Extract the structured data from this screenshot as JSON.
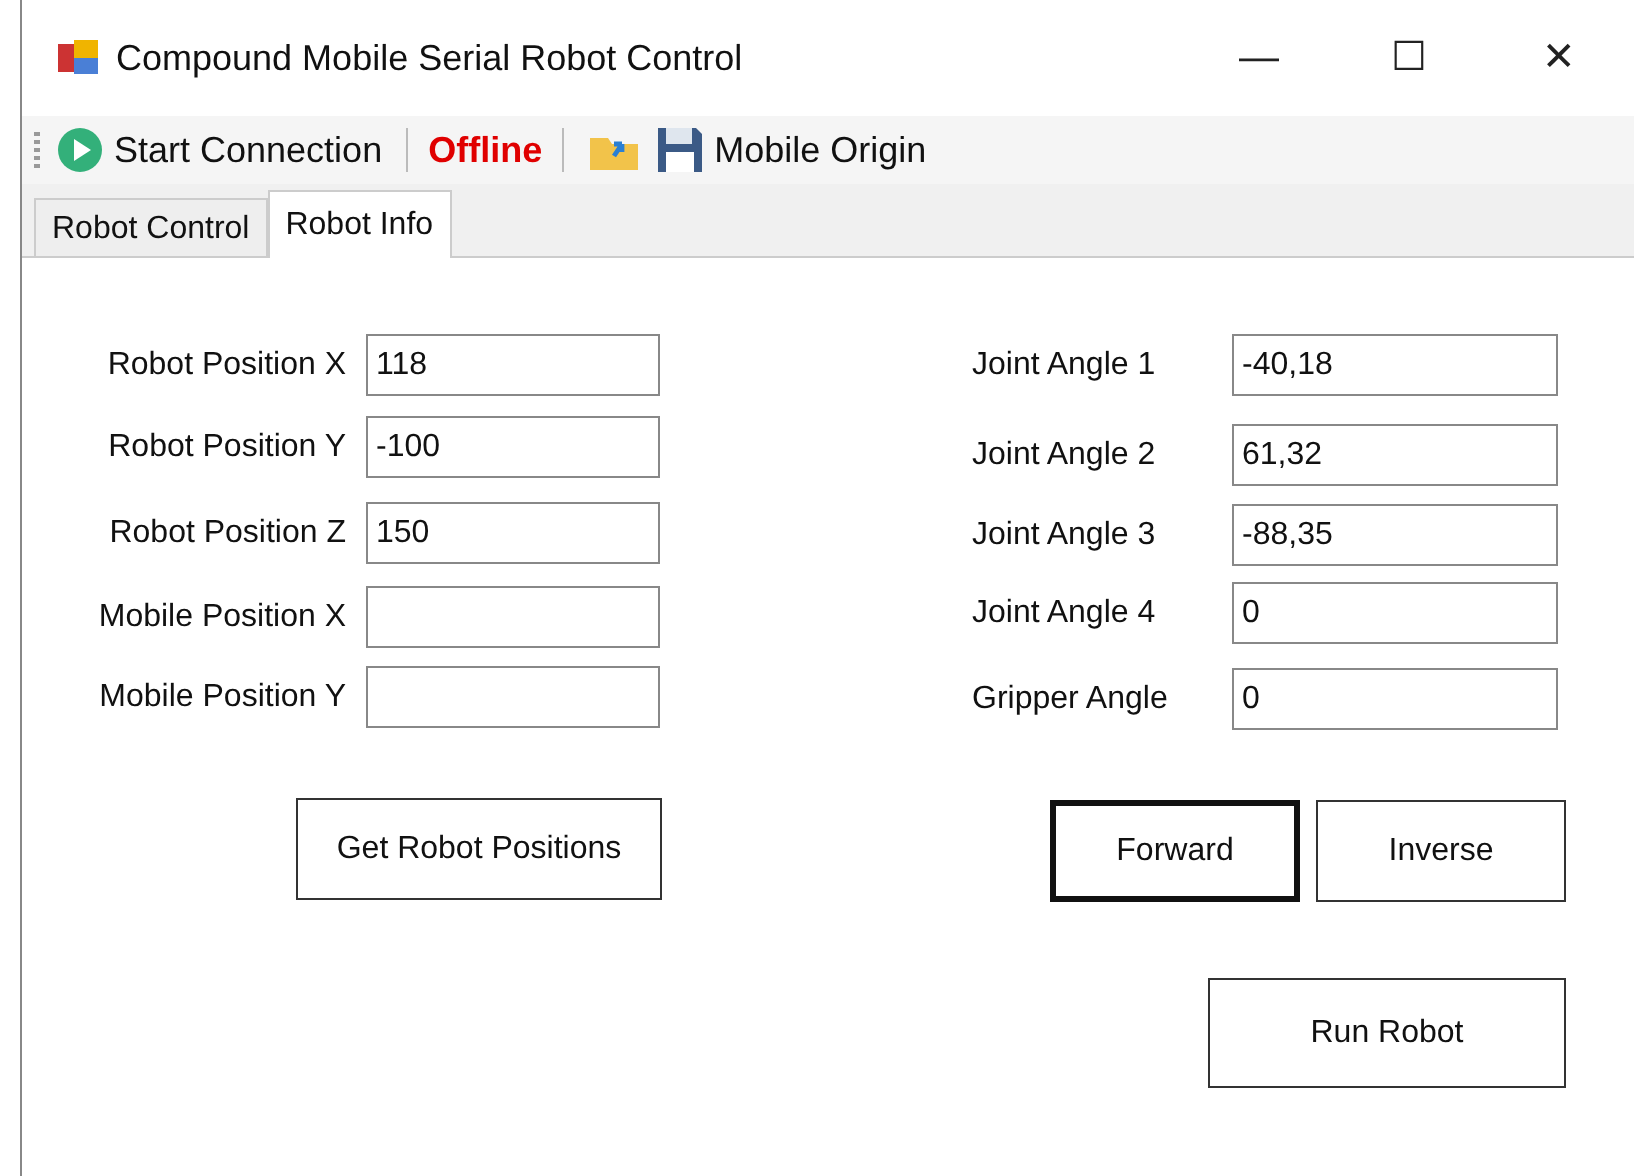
{
  "window": {
    "title": "Compound Mobile Serial Robot Control",
    "controls": [
      "—",
      "☐",
      "✕"
    ]
  },
  "toolbar": {
    "start_button": "Start Connection",
    "status": "Offline",
    "origin_button": "Mobile Origin"
  },
  "tabs": [
    {
      "label": "Robot Control",
      "selected": false
    },
    {
      "label": "Robot Info",
      "selected": true
    }
  ],
  "positions": [
    {
      "label": "Robot Position X",
      "value": "118"
    },
    {
      "label": "Robot Position Y",
      "value": "-100"
    },
    {
      "label": "Robot Position Z",
      "value": "150"
    },
    {
      "label": "Mobile Position X"
    },
    {
      "label": "Mobile Position Y"
    }
  ],
  "get_positions_button": "Get Robot Positions",
  "joints": [
    {
      "label": "Joint Angle 1",
      "value": "-40,18"
    },
    {
      "label": "Joint Angle 2",
      "value": "61,32"
    },
    {
      "label": "Joint Angle 3",
      "value": "-88,35"
    },
    {
      "label": "Joint Angle 4",
      "value": "0"
    },
    {
      "label": "Gripper Angle",
      "value": "0"
    }
  ],
  "kinematics_buttons": [
    {
      "label": "Forward",
      "default": true
    },
    {
      "label": "Inverse",
      "default": false
    }
  ],
  "run_button": "Run Robot"
}
